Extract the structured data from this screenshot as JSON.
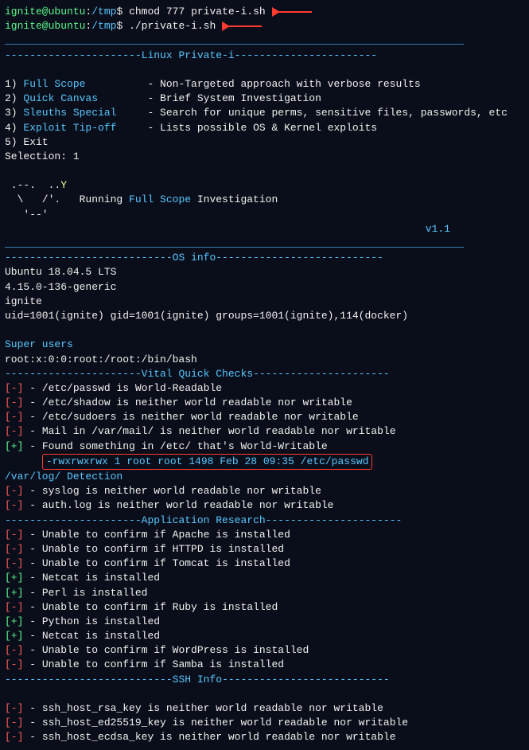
{
  "prompt": {
    "user": "ignite@ubuntu",
    "path": "/tmp",
    "cmd1": "chmod 777 private-i.sh",
    "cmd2": "./private-i.sh"
  },
  "header": "Linux Private-i",
  "menu": [
    {
      "n": "1",
      "label": "Full Scope",
      "desc": "- Non-Targeted approach with verbose results"
    },
    {
      "n": "2",
      "label": "Quick Canvas",
      "desc": "- Brief System Investigation"
    },
    {
      "n": "3",
      "label": "Sleuths Special",
      "desc": "- Search for unique perms, sensitive files, passwords, etc"
    },
    {
      "n": "4",
      "label": "Exploit Tip-off",
      "desc": "- Lists possible OS & Kernel exploits"
    },
    {
      "n": "5",
      "label": "Exit",
      "desc": ""
    }
  ],
  "selection": "Selection: 1",
  "ascii": {
    "l1": " .--.  ..",
    "l1y": "Y",
    "l2": "  \\   /'.   Running ",
    "l2b": "Full Scope",
    "l2c": " Investigation",
    "l3": "   '--'",
    "version": "v1.1"
  },
  "osinfo": {
    "title": "OS info",
    "line1": "Ubuntu 18.04.5 LTS",
    "line2": "4.15.0-136-generic",
    "line3": "ignite",
    "line4": "uid=1001(ignite) gid=1001(ignite) groups=1001(ignite),114(docker)"
  },
  "superusers": {
    "title": "Super users",
    "line": "root:x:0:0:root:/root:/bin/bash"
  },
  "vital": {
    "title": "Vital Quick Checks",
    "items": [
      {
        "s": "[-]",
        "t": "- /etc/passwd is World-Readable"
      },
      {
        "s": "[-]",
        "t": "- /etc/shadow is neither world readable nor writable"
      },
      {
        "s": "[-]",
        "t": "- /etc/sudoers is neither world readable nor writable"
      },
      {
        "s": "[-]",
        "t": "- Mail in /var/mail/ is neither world readable nor writable"
      },
      {
        "s": "[+]",
        "t": "- Found something in /etc/ that's World-Writable"
      }
    ],
    "highlight": "-rwxrwxrwx 1 root root 1498 Feb 28 09:35 /etc/passwd"
  },
  "varlog": {
    "title": "/var/log/ Detection",
    "items": [
      {
        "s": "[-]",
        "t": "- syslog is neither world readable nor writable"
      },
      {
        "s": "[-]",
        "t": "- auth.log is neither world readable nor writable"
      }
    ]
  },
  "app": {
    "title": "Application Research",
    "items": [
      {
        "s": "[-]",
        "t": "- Unable to confirm if Apache is installed"
      },
      {
        "s": "[-]",
        "t": "- Unable to confirm if HTTPD is installed"
      },
      {
        "s": "[-]",
        "t": "- Unable to confirm if Tomcat is installed"
      },
      {
        "s": "[+]",
        "t": "- Netcat is installed"
      },
      {
        "s": "[+]",
        "t": "- Perl is installed"
      },
      {
        "s": "[-]",
        "t": "- Unable to confirm if Ruby is installed"
      },
      {
        "s": "[+]",
        "t": "- Python is installed"
      },
      {
        "s": "[+]",
        "t": "- Netcat is installed"
      },
      {
        "s": "[-]",
        "t": "- Unable to confirm if WordPress is installed"
      },
      {
        "s": "[-]",
        "t": "- Unable to confirm if Samba is installed"
      }
    ]
  },
  "ssh": {
    "title": "SSH Info",
    "items": [
      {
        "s": "[-]",
        "t": "- ssh_host_rsa_key is neither world readable nor writable"
      },
      {
        "s": "[-]",
        "t": "- ssh_host_ed25519_key is neither world readable nor writable"
      },
      {
        "s": "[-]",
        "t": "- ssh_host_ecdsa_key is neither world readable nor writable"
      }
    ]
  }
}
